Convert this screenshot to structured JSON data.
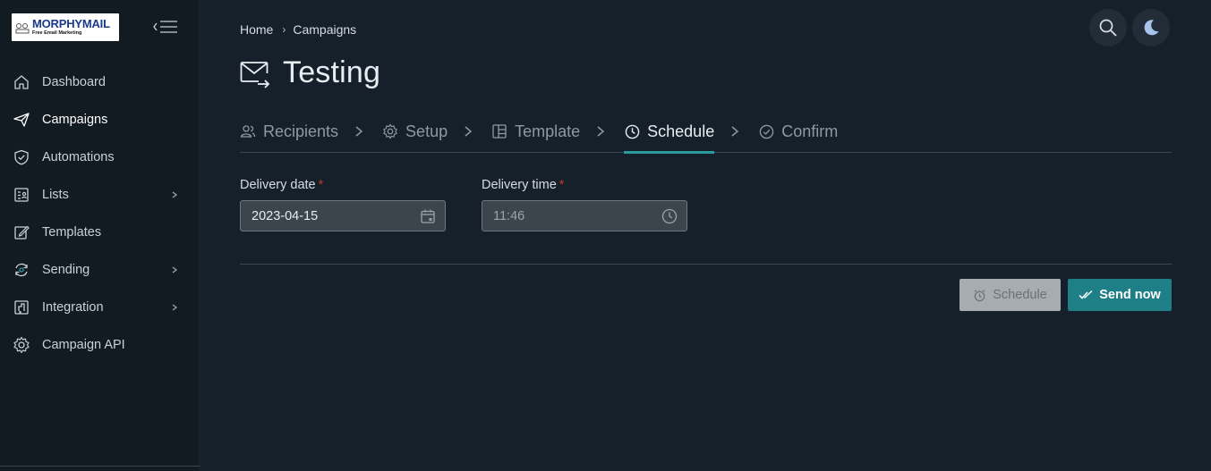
{
  "app": {
    "logo_title": "MORPHYMAIL",
    "logo_subtitle": "Free Email Marketing"
  },
  "sidebar": {
    "items": [
      {
        "label": "Dashboard",
        "icon": "home-icon",
        "has_children": false,
        "active": false
      },
      {
        "label": "Campaigns",
        "icon": "send-icon",
        "has_children": false,
        "active": true
      },
      {
        "label": "Automations",
        "icon": "shield-check-icon",
        "has_children": false,
        "active": false
      },
      {
        "label": "Lists",
        "icon": "list-icon",
        "has_children": true,
        "active": false
      },
      {
        "label": "Templates",
        "icon": "edit-icon",
        "has_children": false,
        "active": false
      },
      {
        "label": "Sending",
        "icon": "sync-icon",
        "has_children": true,
        "active": false
      },
      {
        "label": "Integration",
        "icon": "integration-icon",
        "has_children": true,
        "active": false
      },
      {
        "label": "Campaign API",
        "icon": "gear-icon",
        "has_children": false,
        "active": false
      }
    ]
  },
  "breadcrumb": {
    "items": [
      "Home",
      "Campaigns"
    ]
  },
  "page": {
    "title": "Testing"
  },
  "steps": [
    {
      "label": "Recipients",
      "icon": "users-icon",
      "active": false
    },
    {
      "label": "Setup",
      "icon": "gear-icon",
      "active": false
    },
    {
      "label": "Template",
      "icon": "layout-icon",
      "active": false
    },
    {
      "label": "Schedule",
      "icon": "clock-icon",
      "active": true
    },
    {
      "label": "Confirm",
      "icon": "check-circle-icon",
      "active": false
    }
  ],
  "form": {
    "delivery_date": {
      "label": "Delivery date",
      "value": "2023-04-15",
      "required_mark": "*"
    },
    "delivery_time": {
      "label": "Delivery time",
      "value": "11:46",
      "required_mark": "*"
    }
  },
  "actions": {
    "schedule_label": "Schedule",
    "send_now_label": "Send now"
  },
  "colors": {
    "accent": "#2a9a9b",
    "send_button": "#1f7f86",
    "required": "#c0392b"
  }
}
